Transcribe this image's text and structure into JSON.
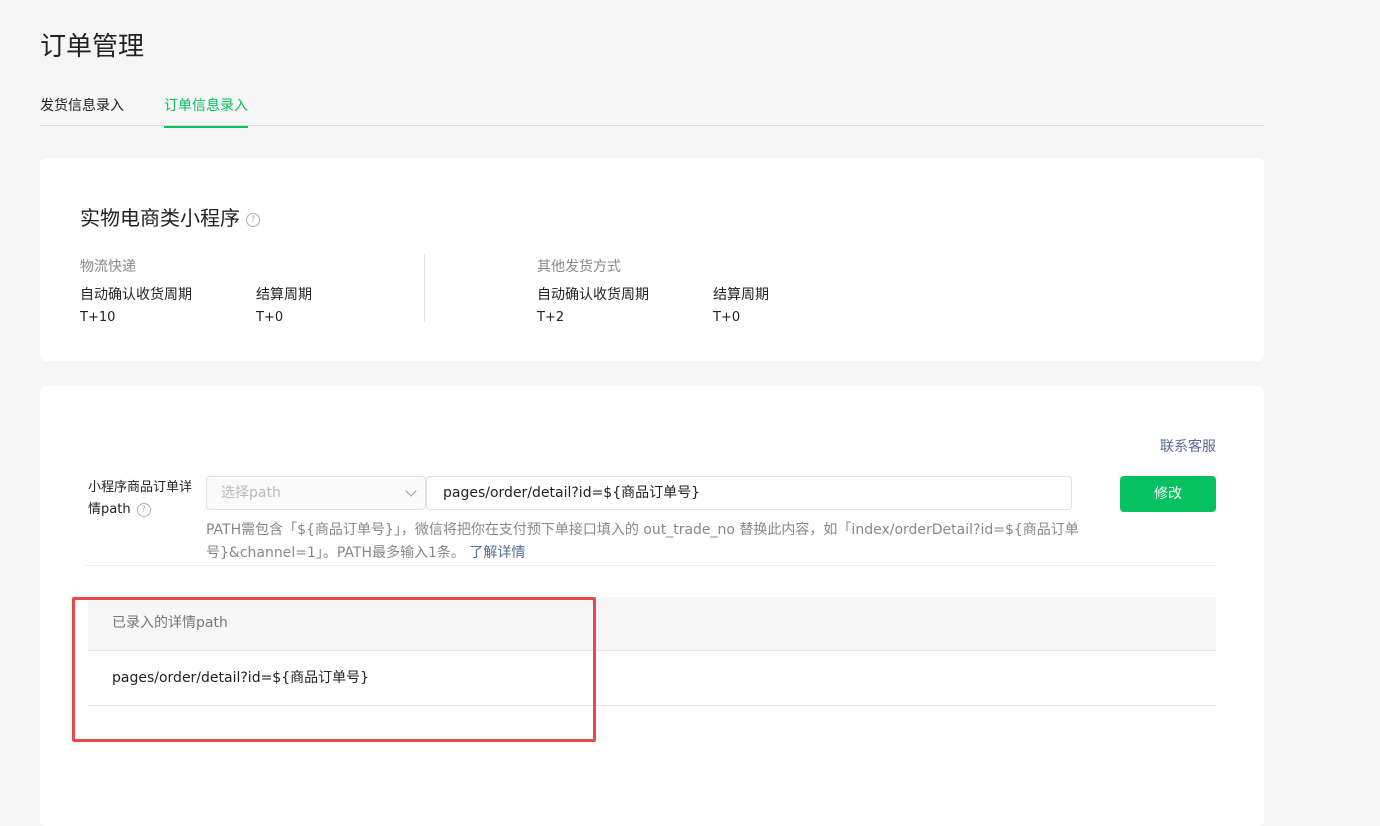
{
  "page": {
    "title": "订单管理"
  },
  "tabs": [
    {
      "label": "发货信息录入"
    },
    {
      "label": "订单信息录入"
    }
  ],
  "card1": {
    "title": "实物电商类小程序",
    "help_icon": "question-circle-icon",
    "groups": [
      {
        "label": "物流快递",
        "items": [
          {
            "key": "自动确认收货周期",
            "value": "T+10"
          },
          {
            "key": "结算周期",
            "value": "T+0"
          }
        ]
      },
      {
        "label": "其他发货方式",
        "items": [
          {
            "key": "自动确认收货周期",
            "value": "T+2"
          },
          {
            "key": "结算周期",
            "value": "T+0"
          }
        ]
      }
    ]
  },
  "card2": {
    "contact_label": "联系客服",
    "form": {
      "label": "小程序商品订单详情path",
      "select_placeholder": "选择path",
      "input_value": "pages/order/detail?id=${商品订单号}",
      "modify_label": "修改",
      "hint_text": "PATH需包含「${商品订单号}」，微信将把你在支付预下单接口填入的 out_trade_no 替换此内容，如「index/orderDetail?id=${商品订单号}&channel=1」。PATH最多输入1条。",
      "hint_link": "了解详情"
    },
    "table": {
      "header": "已录入的详情path",
      "rows": [
        "pages/order/detail?id=${商品订单号}"
      ]
    }
  },
  "colors": {
    "accent": "#07c160",
    "link": "#576b95",
    "highlight": "#e84b4b"
  }
}
